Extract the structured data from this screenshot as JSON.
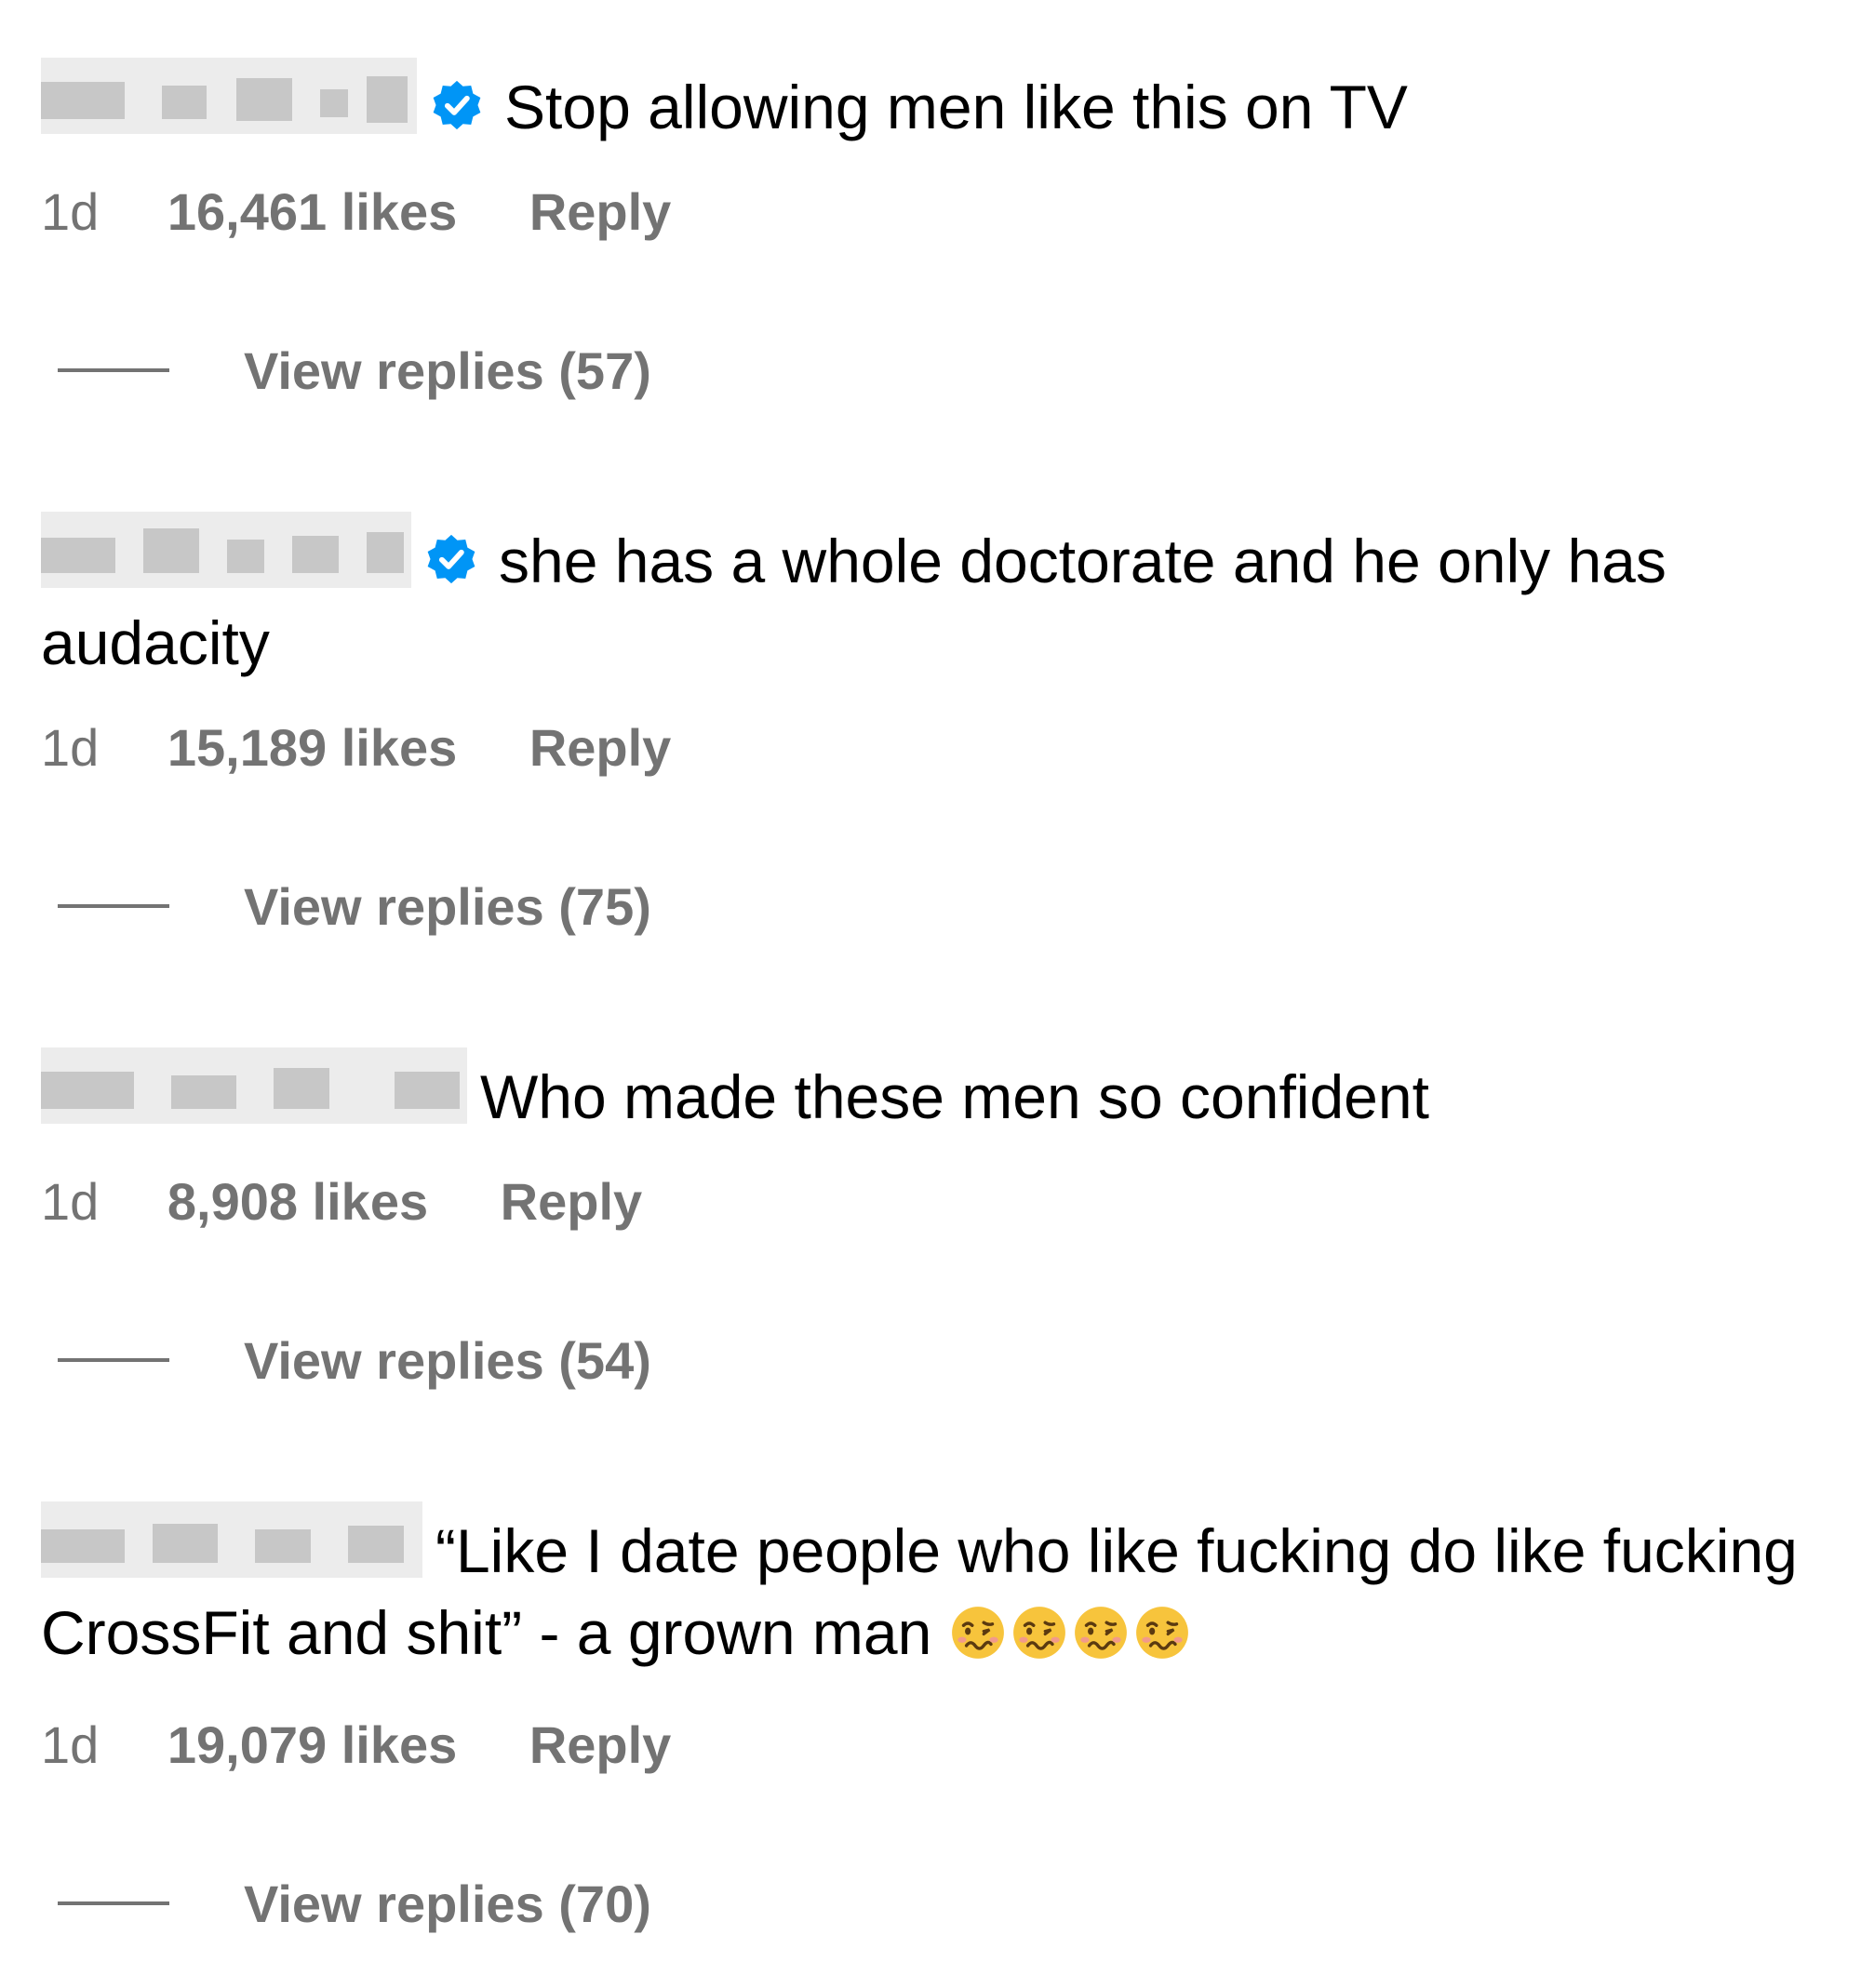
{
  "comments": [
    {
      "username_redacted": true,
      "verified": true,
      "text": "Stop allowing men like this on TV",
      "time": "1d",
      "likes": "16,461 likes",
      "reply_label": "Reply",
      "view_replies_label": "View replies (57)",
      "emojis": []
    },
    {
      "username_redacted": true,
      "verified": true,
      "text": "she has a whole doctorate and he only has audacity",
      "time": "1d",
      "likes": "15,189 likes",
      "reply_label": "Reply",
      "view_replies_label": "View replies (75)",
      "emojis": []
    },
    {
      "username_redacted": true,
      "verified": false,
      "text": "Who made these men so confident",
      "time": "1d",
      "likes": "8,908 likes",
      "reply_label": "Reply",
      "view_replies_label": "View replies (54)",
      "emojis": []
    },
    {
      "username_redacted": true,
      "verified": false,
      "text": "“Like I date people who like fucking do like fucking CrossFit and shit” - a grown man",
      "time": "1d",
      "likes": "19,079 likes",
      "reply_label": "Reply",
      "view_replies_label": "View replies (70)",
      "emojis": [
        "woozy-face-icon",
        "woozy-face-icon",
        "woozy-face-icon",
        "woozy-face-icon"
      ]
    }
  ],
  "colors": {
    "text": "#000000",
    "secondary": "#737373",
    "verified_blue": "#0095f6",
    "redaction": "#ececec",
    "emoji_yellow": "#f7c43c"
  }
}
